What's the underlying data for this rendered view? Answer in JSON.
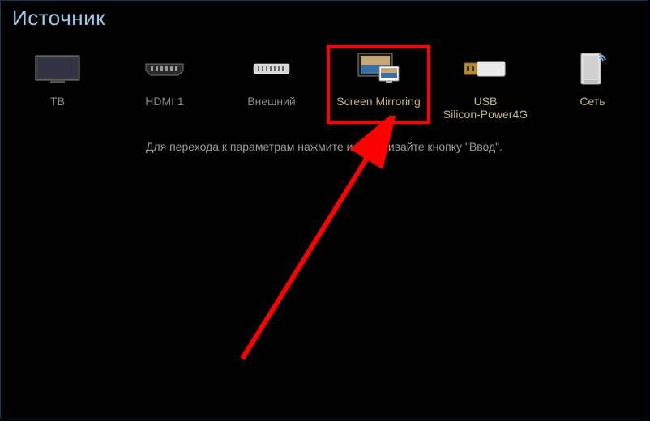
{
  "title": "Источник",
  "hint": "Для перехода к параметрам нажмите и удерживайте кнопку \"Ввод\".",
  "sources": [
    {
      "id": "tv",
      "label": "ТВ",
      "highlighted": false
    },
    {
      "id": "hdmi1",
      "label": "HDMI 1",
      "highlighted": false
    },
    {
      "id": "ext",
      "label": "Внешний",
      "highlighted": false
    },
    {
      "id": "screen-mirroring",
      "label": "Screen Mirroring",
      "highlighted": true
    },
    {
      "id": "usb",
      "label": "USB\nSilicon-Power4G",
      "highlighted": false
    },
    {
      "id": "net",
      "label": "Сеть",
      "highlighted": false
    }
  ],
  "colors": {
    "title": "#9ec9e6",
    "label": "#c9b28a",
    "hint": "#9a9a9a",
    "highlight": "#ff0000"
  }
}
